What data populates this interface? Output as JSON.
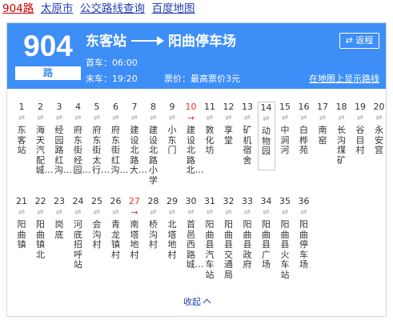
{
  "page_link": {
    "route": "904路",
    "city": "太原市",
    "query": "公交路线查询",
    "source": "百度地图"
  },
  "header": {
    "number": "904",
    "unit": "路",
    "origin": "东客站",
    "destination": "阳曲停车场",
    "reverse_label": "返程",
    "first_bus": "首车：06:00",
    "last_bus": "末车：19:20",
    "fare": "票价：最高票价3元",
    "map_link": "在地图上显示路线"
  },
  "stops": [
    {
      "num": "1",
      "name": "东客站"
    },
    {
      "num": "2",
      "name": "海天汽配城…"
    },
    {
      "num": "3",
      "name": "经园路红沟…"
    },
    {
      "num": "4",
      "name": "府东街经园…"
    },
    {
      "num": "5",
      "name": "府东街太行…"
    },
    {
      "num": "6",
      "name": "府东街红沟…"
    },
    {
      "num": "7",
      "name": "建设北路大…"
    },
    {
      "num": "8",
      "name": "建设北路小学"
    },
    {
      "num": "9",
      "name": "小东门"
    },
    {
      "num": "10",
      "name": "建设北路北…"
    },
    {
      "num": "11",
      "name": "敦化坊"
    },
    {
      "num": "12",
      "name": "享堂"
    },
    {
      "num": "13",
      "name": "矿机宿舍"
    },
    {
      "num": "14",
      "name": "动物园"
    },
    {
      "num": "15",
      "name": "中涧河"
    },
    {
      "num": "16",
      "name": "白桦苑"
    },
    {
      "num": "17",
      "name": "南窑"
    },
    {
      "num": "18",
      "name": "长沟煤矿"
    },
    {
      "num": "19",
      "name": "谷目村"
    },
    {
      "num": "20",
      "name": "永安宫"
    },
    {
      "num": "21",
      "name": "阳曲镇"
    },
    {
      "num": "22",
      "name": "阳曲镇北"
    },
    {
      "num": "23",
      "name": "岗底"
    },
    {
      "num": "24",
      "name": "河底招呼站"
    },
    {
      "num": "25",
      "name": "会沟村"
    },
    {
      "num": "26",
      "name": "青龙镇村"
    },
    {
      "num": "27",
      "name": "南塔地村"
    },
    {
      "num": "28",
      "name": "桥沟村"
    },
    {
      "num": "29",
      "name": "北塔地村"
    },
    {
      "num": "30",
      "name": "首邑西路城…"
    },
    {
      "num": "31",
      "name": "阳曲县汽车站"
    },
    {
      "num": "32",
      "name": "阳曲县交通局"
    },
    {
      "num": "33",
      "name": "阳曲县政府"
    },
    {
      "num": "34",
      "name": "阳曲县广场"
    },
    {
      "num": "35",
      "name": "阳曲县火车站"
    },
    {
      "num": "36",
      "name": "阳曲停车场"
    }
  ],
  "collapse_label": "收起",
  "colors": {
    "header_bg": "#3e8ef7",
    "link": "#2440b3",
    "alert": "#e33333"
  }
}
